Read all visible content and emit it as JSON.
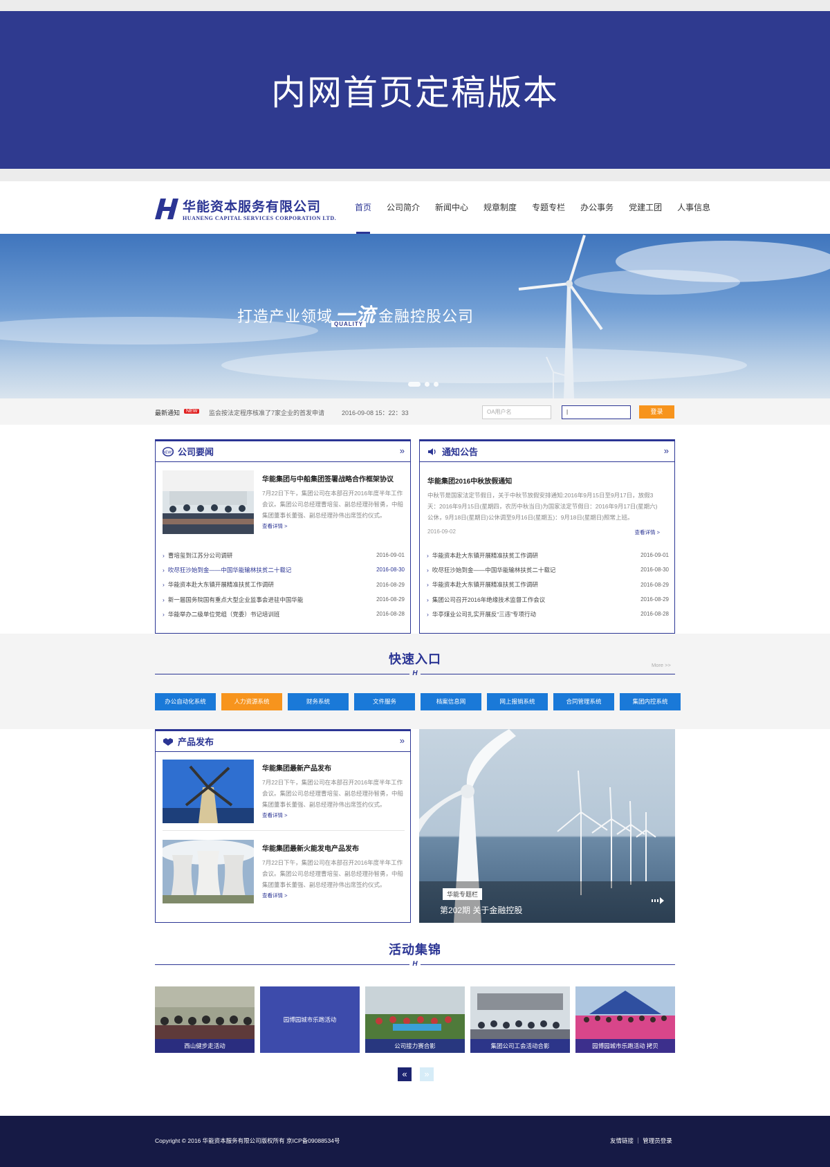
{
  "banner": {
    "title": "内网首页定稿版本"
  },
  "logo": {
    "cn": "华能资本服务有限公司",
    "en": "HUANENG CAPITAL SERVICES CORPORATION LTD."
  },
  "nav": [
    "首页",
    "公司简介",
    "新闻中心",
    "规章制度",
    "专题专栏",
    "办公事务",
    "党建工团",
    "人事信息"
  ],
  "hero": {
    "slogan_pre": "打造产业领域",
    "slogan_mid": "一流",
    "slogan_post": "金融控股公司",
    "quality": "QUALITY"
  },
  "noticebar": {
    "label": "最新通知",
    "badge": "NEW",
    "text": "监会按法定程序核准了7家企业的首发申请",
    "date": "2016-09-08 15：22：33",
    "username_placeholder": "OA用户名",
    "login_label": "登录"
  },
  "news": {
    "title": "公司要闻",
    "feature": {
      "title": "华能集团与中船集团签署战略合作框架协议",
      "desc": "7月22日下午，集团公司在本部召开2016年度半年工作会议。集团公司总经理曹培玺、副总经理孙智勇，中船集团董事长董强、副总经理孙伟出席签约仪式。",
      "more": "查看详情 >"
    },
    "items": [
      {
        "title": "曹培玺到江苏分公司调研",
        "date": "2016-09-01"
      },
      {
        "title": "吹尽狂沙始到金——中国华能输林扶贫二十载记",
        "date": "2016-08-30"
      },
      {
        "title": "华能资本赴大东镇开展精准扶贫工作调研",
        "date": "2016-08-29"
      },
      {
        "title": "新一届国务院国有重点大型企业监事会进驻中国华能",
        "date": "2016-08-29"
      },
      {
        "title": "华能举办二级单位党组（党委）书记培训班",
        "date": "2016-08-28"
      }
    ]
  },
  "notice": {
    "title": "通知公告",
    "feature": {
      "title": "华能集团2016中秋放假通知",
      "desc": "中秋节是国家法定节假日，关于中秋节放假安排通知:2016年9月15日至9月17日，放假3天：2016年9月15日(星期四，农历中秋当日)为国家法定节假日：2016年9月17日(星期六)公休，9月18日(星期日)公休调至9月16日(星期五)：9月18日(星期日)照常上班。",
      "date": "2016-09-02",
      "more": "查看详情 >"
    },
    "items": [
      {
        "title": "华能资本赴大东镇开展精准扶贫工作调研",
        "date": "2016-09-01"
      },
      {
        "title": "吹尽狂沙始到金——中国华能输林扶贫二十载记",
        "date": "2016-08-30"
      },
      {
        "title": "华能资本赴大东镇开展精准扶贫工作调研",
        "date": "2016-08-29"
      },
      {
        "title": "集团公司召开2016年绝缘技术监督工作会议",
        "date": "2016-08-29"
      },
      {
        "title": "华亭煤业公司扎实开展反“三违”专项行动",
        "date": "2016-08-28"
      }
    ]
  },
  "quick": {
    "title": "快速入口",
    "more": "More >>",
    "buttons": [
      "办公自动化系统",
      "人力资源系统",
      "财务系统",
      "文件服务",
      "档案信息网",
      "网上报销系统",
      "合同管理系统",
      "集团内控系统"
    ]
  },
  "products": {
    "title": "产品发布",
    "items": [
      {
        "title": "华能集团最新产品发布",
        "desc": "7月22日下午，集团公司在本部召开2016年度半年工作会议。集团公司总经理曹培玺、副总经理孙智勇，中船集团董事长董强、副总经理孙伟出席签约仪式。",
        "more": "查看详情 >"
      },
      {
        "title": "华能集团最新火能发电产品发布",
        "desc": "7月22日下午，集团公司在本部召开2016年度半年工作会议。集团公司总经理曹培玺、副总经理孙智勇，中船集团董事长董强、副总经理孙伟出席签约仪式。",
        "more": "查看详情 >"
      }
    ]
  },
  "special": {
    "tag": "华能专题栏",
    "title": "第202期 关于金融控股"
  },
  "gallery": {
    "title": "活动集锦",
    "items": [
      "西山健步走活动",
      "园博园城市乐跑活动",
      "公司接力赛合影",
      "集团公司工会活动合影",
      "园博园城市乐跑活动 拷贝"
    ]
  },
  "pager": {
    "prev": "«",
    "next": "»"
  },
  "footer": {
    "copyright": "Copyright © 2016 华能资本服务有限公司版权所有 京ICP备09088534号",
    "links": "友情链接 ｜ 管理员登录"
  },
  "colors": {
    "brand": "#2b3594",
    "accent": "#f7941d",
    "quick_button": "#1a79d8",
    "footer": "#161a45"
  }
}
